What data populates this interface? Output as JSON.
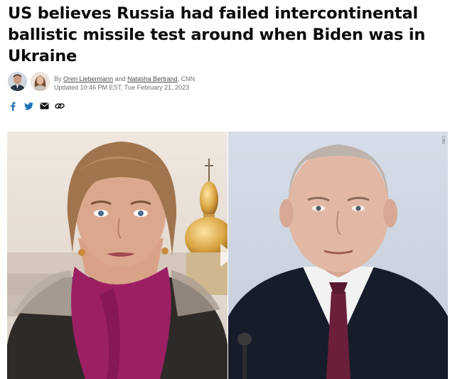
{
  "article": {
    "headline": "US believes Russia had failed intercontinental ballistic missile test around when Biden was in Ukraine",
    "byline_prefix": "By ",
    "author_1": "Oren Liebermann",
    "byline_and": " and ",
    "author_2": "Natasha Bertrand",
    "byline_suffix": ", CNN",
    "updated": "Updated 10:46 PM EST, Tue February 21, 2023"
  },
  "share_icons": [
    "facebook-icon",
    "twitter-icon",
    "email-icon",
    "link-icon"
  ],
  "colors": {
    "headline": "#0c0c0c",
    "byline": "#6e6e6e",
    "icon_blue": "#1a73b8",
    "scarf": "#9c1f63",
    "dome_gold": "#d9a441",
    "tie": "#6b1f3a"
  },
  "media": {
    "watermark": "CNN"
  }
}
